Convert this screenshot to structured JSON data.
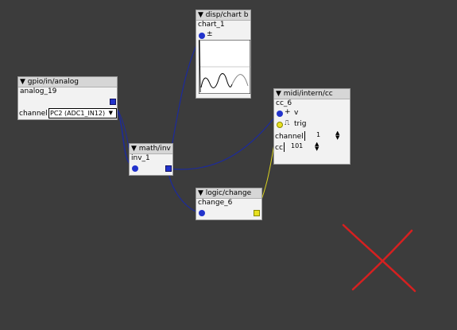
{
  "objects": {
    "gpio": {
      "type": "gpio/in/analog",
      "instance": "analog_19",
      "channel_label": "channel",
      "channel_value": "PC2 (ADC1_IN12)"
    },
    "chart": {
      "type": "disp/chart b",
      "instance": "chart_1",
      "pin_label": "±"
    },
    "midi": {
      "type": "midi/intern/cc",
      "instance": "cc_6",
      "v_label": "v",
      "trig_label": "trig",
      "channel_label": "channel",
      "channel_value": "1",
      "cc_label": "cc",
      "cc_value": "101"
    },
    "inv": {
      "type": "math/inv",
      "instance": "inv_1"
    },
    "change": {
      "type": "logic/change",
      "instance": "change_6"
    }
  },
  "colors": {
    "canvas": "#3c3c3c",
    "wire_frac": "#1c2a9c",
    "wire_bool": "#d8d020",
    "cross": "#d62020"
  },
  "icons": {
    "collapse": "triangle-down-icon",
    "delete_marker": "red-cross-icon"
  }
}
